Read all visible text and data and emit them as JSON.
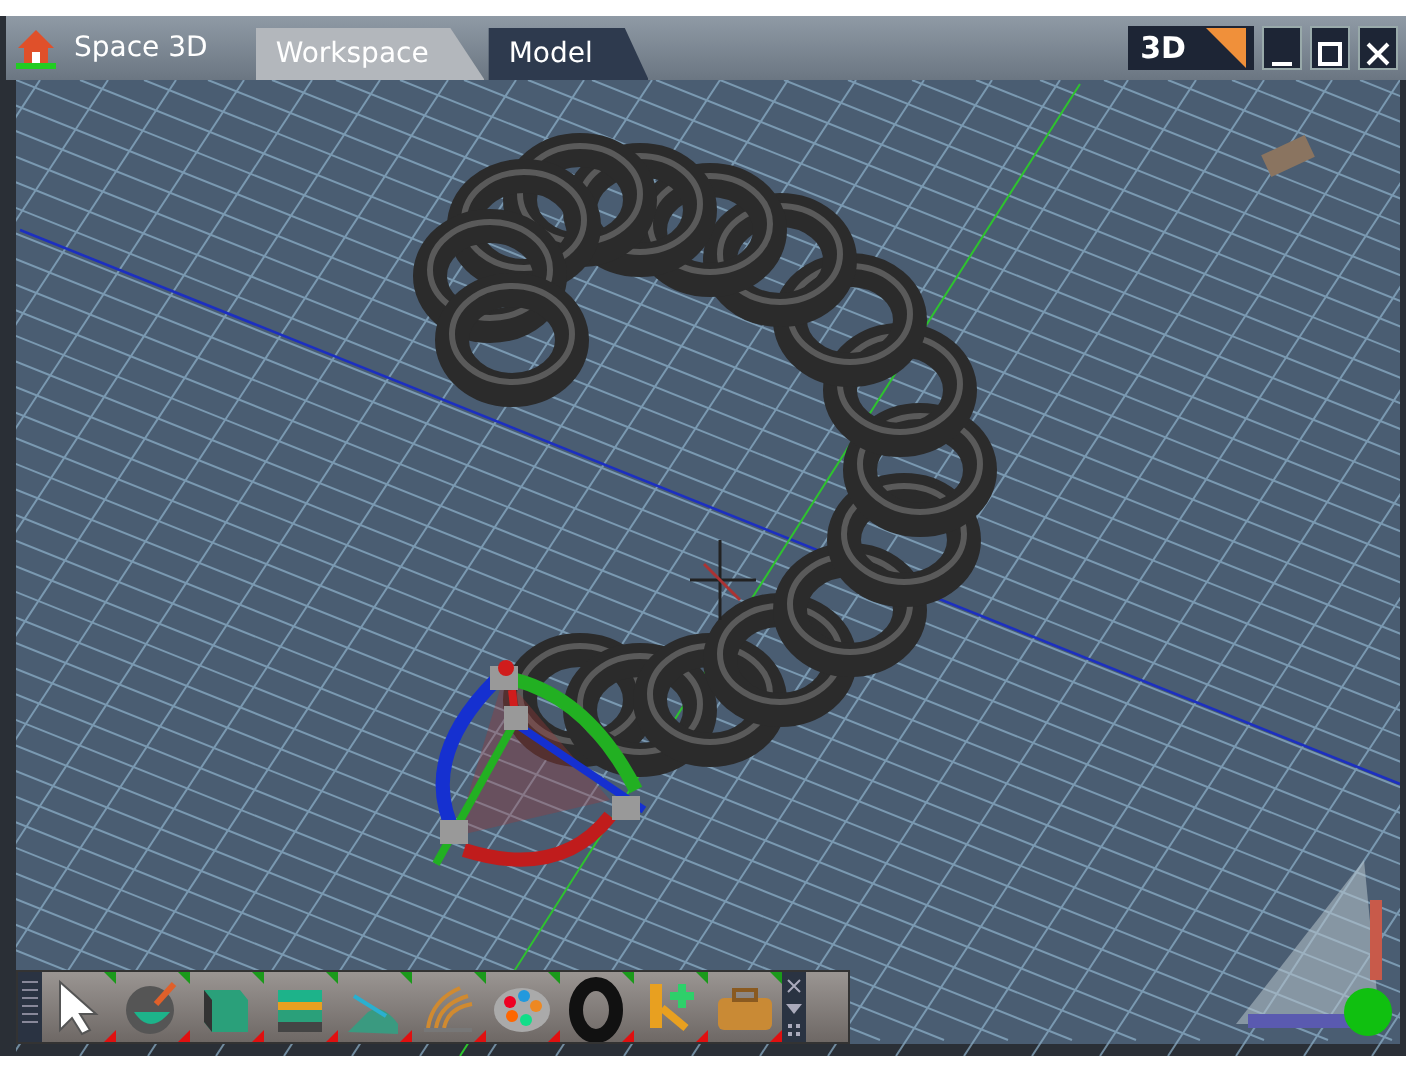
{
  "window": {
    "title": "Space 3D"
  },
  "tabs": [
    {
      "label": "Workspace",
      "selected": true
    },
    {
      "label": "Model",
      "selected": false
    }
  ],
  "view_mode_button": {
    "label": "3D"
  }
}
